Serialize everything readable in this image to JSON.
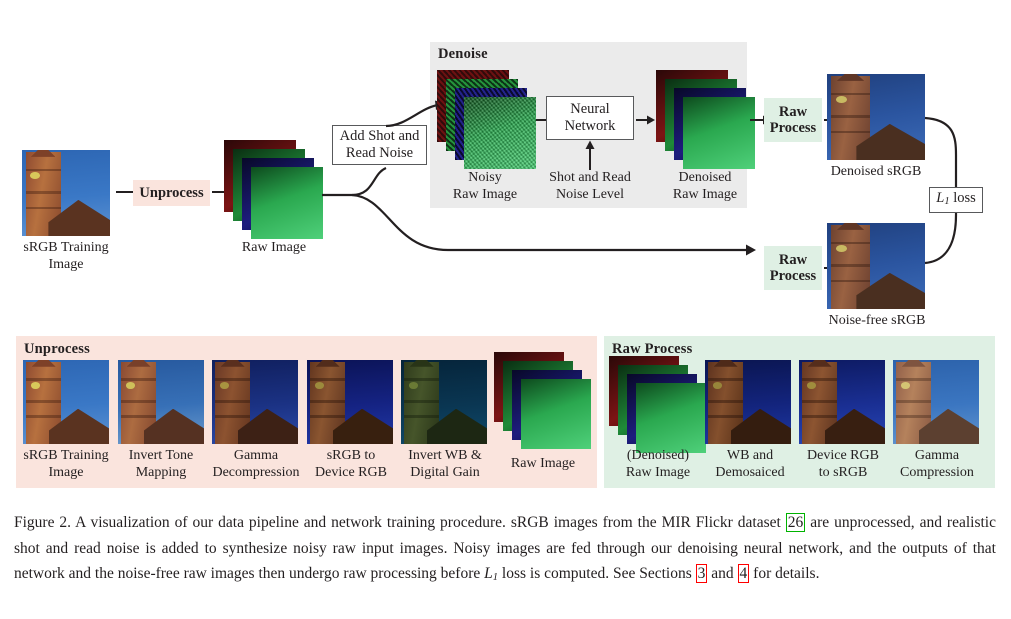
{
  "figure": {
    "label": "Figure 2.",
    "caption_part1": "A visualization of our data pipeline and network training procedure. sRGB images from the MIR Flickr dataset ",
    "ref_26": "26",
    "caption_part2": " are unprocessed, and realistic shot and read noise is added to synthesize noisy raw input images. Noisy images are fed through our denoising neural network, and the outputs of that network and the noise-free raw images then undergo raw processing before ",
    "loss_symbol_base": "L",
    "loss_symbol_sub": "1",
    "caption_part3": " loss is computed. See Sections ",
    "ref_sec_a": "3",
    "caption_and": " and ",
    "ref_sec_b": "4",
    "caption_part4": " for details."
  },
  "pipeline": {
    "srgb_training_image_label": "sRGB Training\nImage",
    "unprocess_button": "Unprocess",
    "raw_image_label": "Raw Image",
    "add_noise_box": "Add Shot and\nRead Noise",
    "denoise_panel_title": "Denoise",
    "noisy_raw_image_label": "Noisy\nRaw Image",
    "neural_network_box": "Neural\nNetwork",
    "shot_read_noise_level_label": "Shot and Read\nNoise Level",
    "denoised_raw_image_label": "Denoised\nRaw Image",
    "raw_process_top_button": "Raw\nProcess",
    "raw_process_bottom_button": "Raw\nProcess",
    "denoised_srgb_label": "Denoised sRGB",
    "noise_free_srgb_label": "Noise-free sRGB",
    "l1_loss_box_base": "L",
    "l1_loss_box_sub": "1",
    "l1_loss_box_word": "loss"
  },
  "unprocess_panel": {
    "title": "Unprocess",
    "steps": [
      {
        "label": "sRGB Training\nImage",
        "kind": "photo-srgb"
      },
      {
        "label": "Invert Tone\nMapping",
        "kind": "photo-invtone"
      },
      {
        "label": "Gamma\nDecompression",
        "kind": "photo-gamma"
      },
      {
        "label": "sRGB to\nDevice RGB",
        "kind": "photo-device"
      },
      {
        "label": "Invert WB &\nDigital Gain",
        "kind": "photo-wb"
      },
      {
        "label": "Raw Image",
        "kind": "stack-raw"
      }
    ]
  },
  "raw_process_panel": {
    "title": "Raw Process",
    "steps": [
      {
        "label": "(Denoised)\nRaw Image",
        "kind": "stack-raw"
      },
      {
        "label": "WB and\nDemosaiced",
        "kind": "photo-wbdemo"
      },
      {
        "label": "Device RGB\nto sRGB",
        "kind": "photo-dev2srgb"
      },
      {
        "label": "Gamma\nCompression",
        "kind": "photo-gammacomp"
      }
    ]
  },
  "colors": {
    "unprocess_pink": "#fae4dd",
    "raw_process_green": "#dff0e4",
    "denoise_gray": "#ebebeb",
    "stroke": "#231f20",
    "box_border": "#58595b",
    "ref_red": "#ff0000",
    "ref_green": "#00b300",
    "sky_blue": "#2f6bb5",
    "brick": "#9e5f42"
  }
}
